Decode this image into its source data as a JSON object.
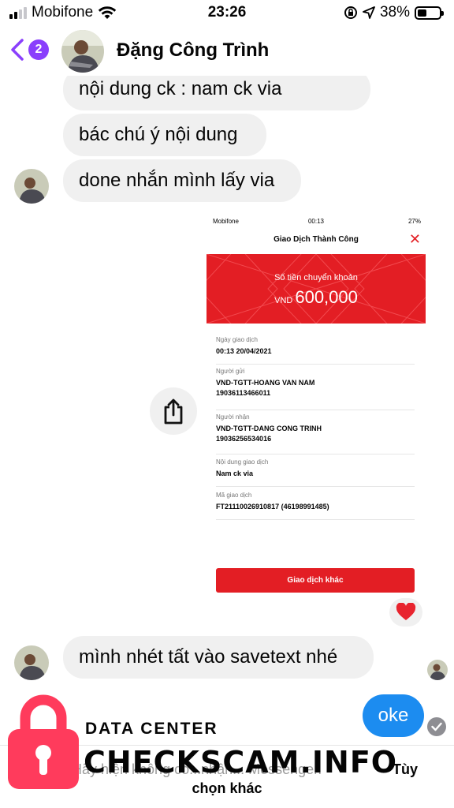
{
  "status_bar": {
    "carrier": "Mobifone",
    "time": "23:26",
    "battery": "38%"
  },
  "header": {
    "unread_count": "2",
    "contact_name": "Đặng Công Trình"
  },
  "messages": [
    {
      "from": "contact",
      "text": "nội dung ck : nam ck via"
    },
    {
      "from": "contact",
      "text": "bác chú ý nội dung"
    },
    {
      "from": "contact",
      "text": "done nhắn mình lấy via"
    },
    {
      "from": "contact",
      "text": "mình nhét tất vào savetext nhé"
    },
    {
      "from": "me",
      "text": "oke"
    }
  ],
  "receipt": {
    "status_carrier": "Mobifone",
    "status_time": "00:13",
    "status_battery": "27%",
    "title": "Giao Dịch Thành Công",
    "amount_label": "Số tiền chuyển khoản",
    "currency": "VND",
    "amount": "600,000",
    "fields": [
      {
        "label": "Ngày giao dịch",
        "value": "00:13 20/04/2021"
      },
      {
        "label": "Người gửi",
        "value": "VND-TGTT-HOANG VAN NAM",
        "value2": "19036113466011"
      },
      {
        "label": "Người nhận",
        "value": "VND-TGTT-DANG CONG TRINH",
        "value2": "19036256534016"
      },
      {
        "label": "Nội dung giao dịch",
        "value": "Nam ck via"
      },
      {
        "label": "Mã giao dịch",
        "value": "FT21110026910817 (46198991485)"
      }
    ],
    "button_label": "Giao dịch khác",
    "accent_color": "#e31e24"
  },
  "reaction": "heart",
  "notice": {
    "text": "Mi...i Hãy hiện không có...nhận... Messenger.",
    "action_line1": "Tùy",
    "action_line2": "chọn khác"
  },
  "watermark": {
    "subtitle": "DATA CENTER",
    "title": "CHECKSCAM.INFO"
  },
  "colors": {
    "accent": "#8a3ffc",
    "my_bubble": "#1c8cf0",
    "watermark_lock": "#ff3b5c"
  }
}
